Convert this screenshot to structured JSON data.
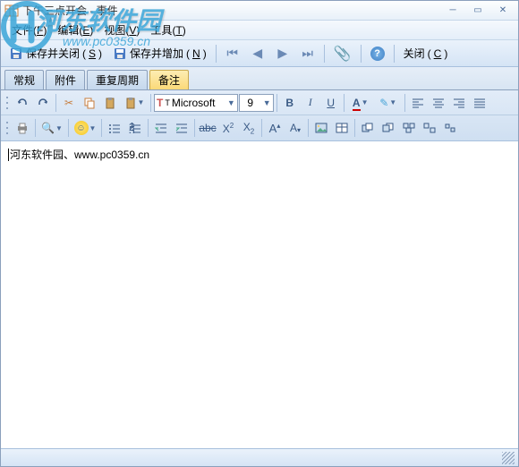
{
  "window": {
    "title": "下午三点开会 - 事件"
  },
  "watermark": {
    "name": "河东软件园",
    "url": "www.pc0359.cn"
  },
  "menu": {
    "file": "文件",
    "file_key": "F",
    "edit": "编辑",
    "edit_key": "E",
    "view": "视图",
    "view_key": "V",
    "tools": "工具",
    "tools_key": "T"
  },
  "toolbar": {
    "save_close": "保存并关闭",
    "save_close_key": "S",
    "save_add": "保存并增加",
    "save_add_key": "N",
    "close": "关闭",
    "close_key": "C"
  },
  "tabs": {
    "general": "常规",
    "attachments": "附件",
    "recurrence": "重复周期",
    "notes": "备注"
  },
  "editor": {
    "font_name": "Microsoft",
    "font_size": "9"
  },
  "content": {
    "text": "河东软件园、www.pc0359.cn"
  }
}
